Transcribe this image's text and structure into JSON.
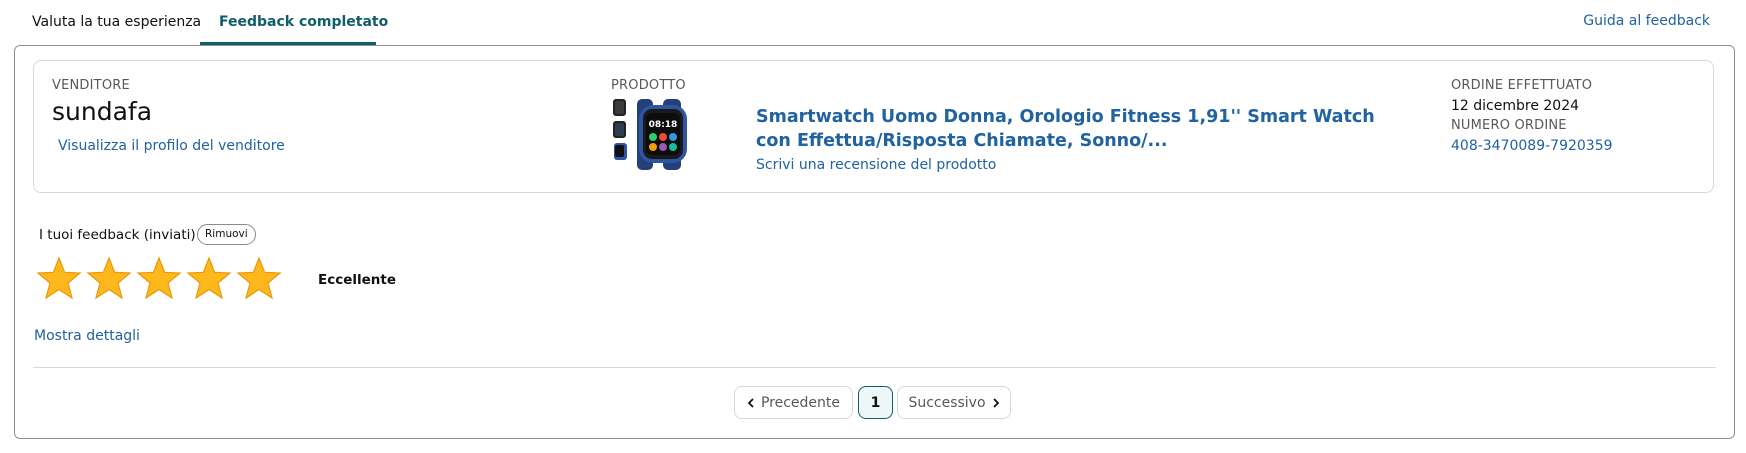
{
  "tabs": [
    {
      "label": "Valuta la tua esperienza",
      "active": false
    },
    {
      "label": "Feedback completato",
      "active": true
    }
  ],
  "guide_link": "Guida al feedback",
  "seller": {
    "label": "VENDITORE",
    "name": "sundafa",
    "profile_link": "Visualizza il profilo del venditore"
  },
  "product": {
    "label": "PRODOTTO",
    "title": "Smartwatch Uomo Donna, Orologio Fitness 1,91'' Smart Watch con Effettua/Risposta Chiamate, Sonno/...",
    "review_link": "Scrivi una recensione del prodotto",
    "thumbnail_time": "08:18"
  },
  "order": {
    "placed_label": "ORDINE EFFETTUATO",
    "date": "12 dicembre 2024",
    "number_label": "NUMERO ORDINE",
    "number": "408-3470089-7920359"
  },
  "feedback": {
    "label": "I tuoi feedback (inviati)",
    "remove_label": "Rimuovi",
    "stars": 5,
    "max_stars": 5,
    "rating_text": "Eccellente",
    "show_details": "Mostra dettagli"
  },
  "pagination": {
    "prev_label": "Precedente",
    "current_page": "1",
    "next_label": "Successivo"
  },
  "colors": {
    "accent": "#0f5e6b",
    "link": "#2162a1",
    "star": "#ffa41c"
  }
}
